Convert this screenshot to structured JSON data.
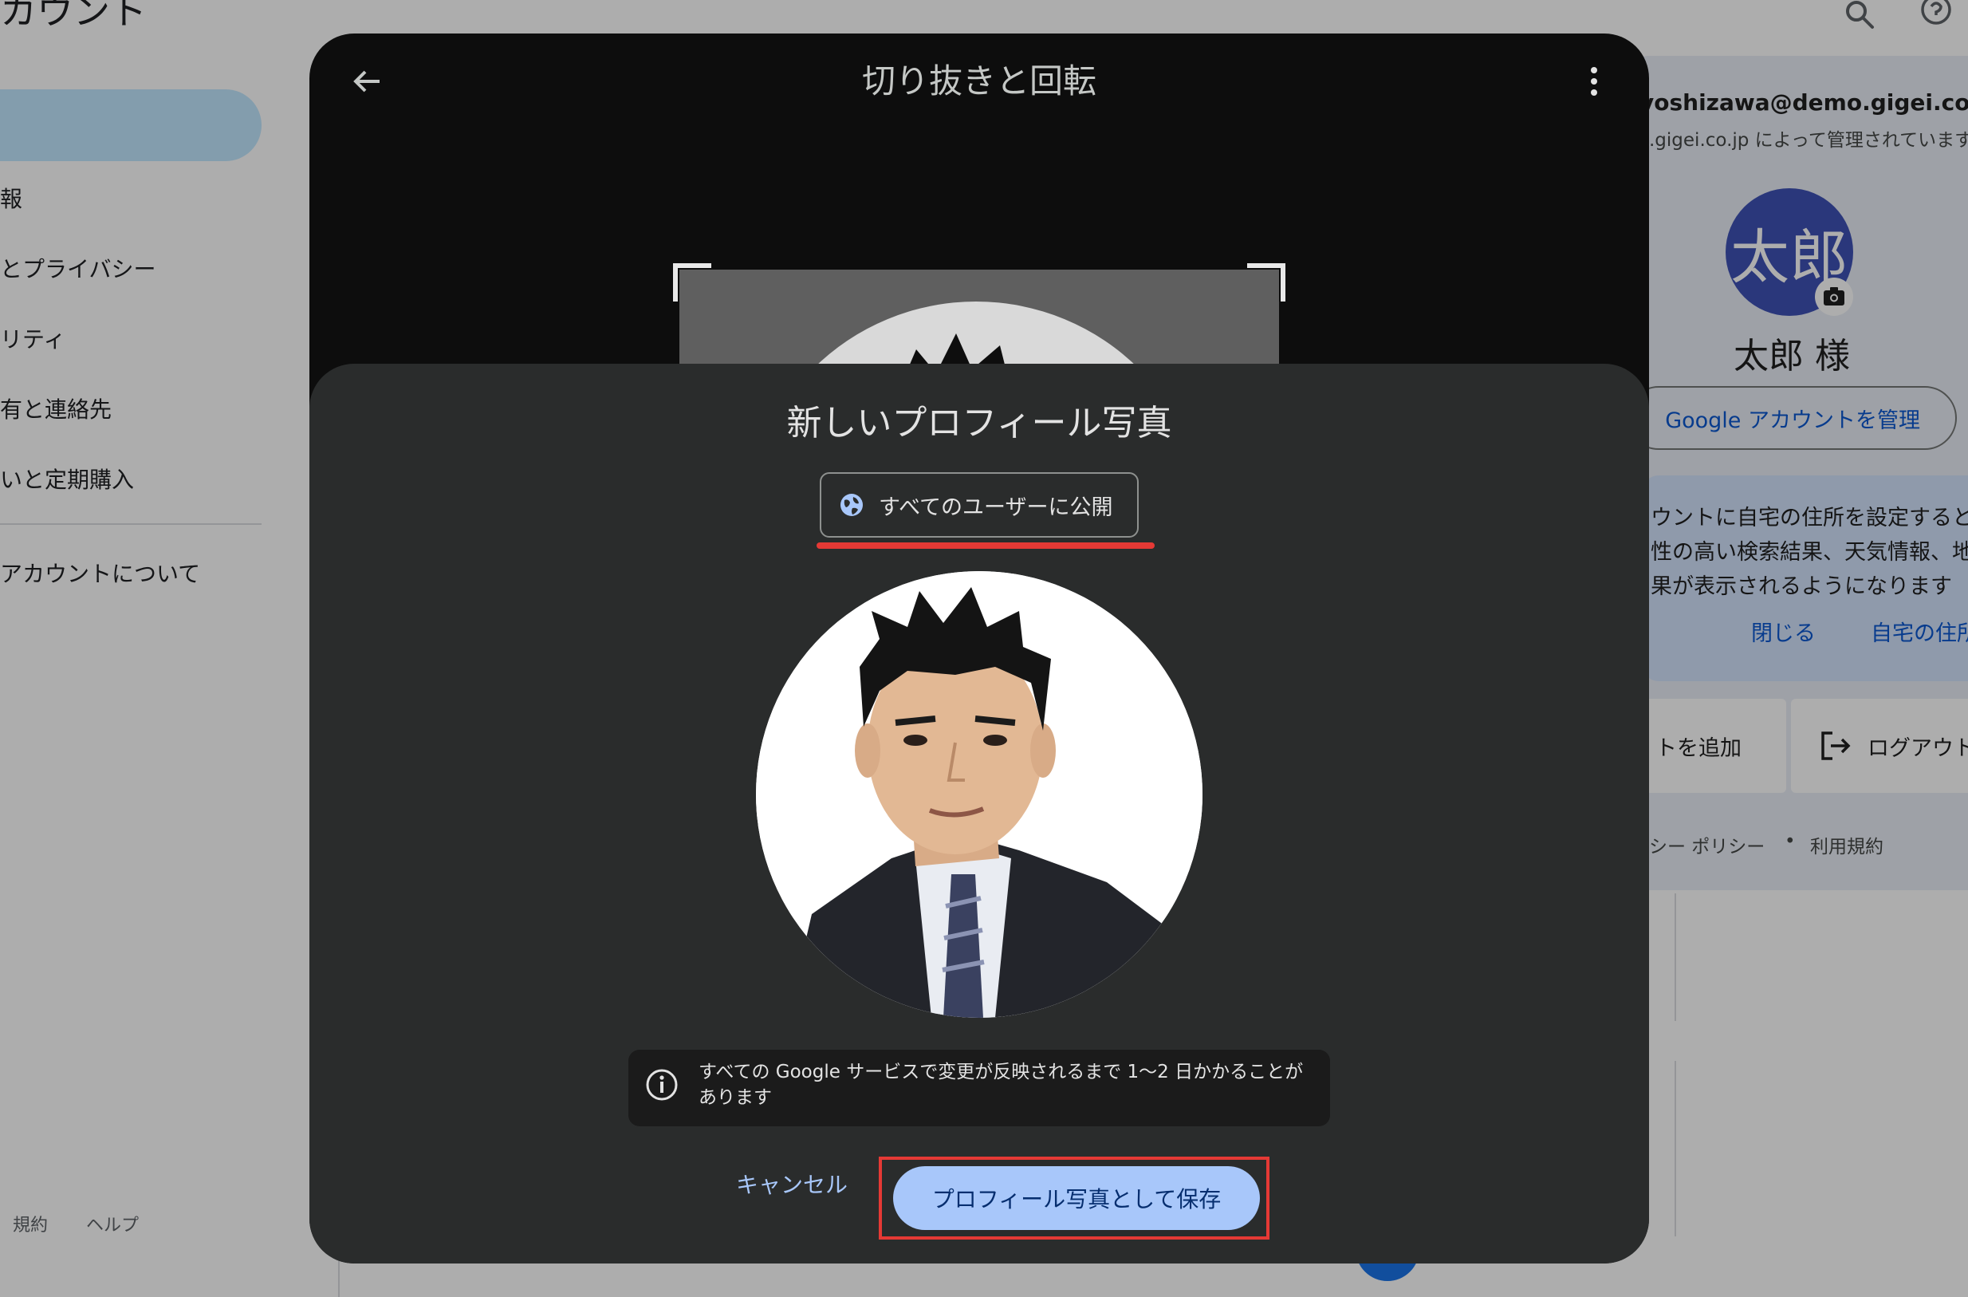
{
  "background": {
    "page_title": "カウント",
    "nav": {
      "items": [
        "報",
        "とプライバシー",
        "リティ",
        "有と連絡先",
        "いと定期購入",
        "アカウントについて"
      ]
    },
    "footer": {
      "terms": "規約",
      "help": "ヘルプ"
    },
    "icons": {
      "search": "search-icon",
      "help": "help-circle-icon"
    }
  },
  "account_panel": {
    "email": "yoshizawa@demo.gigei.co.jp",
    "managed_by": ".gigei.co.jp によって管理されています",
    "avatar_text": "太郎",
    "greeting": "太郎 様",
    "manage_button": "Google アカウントを管理",
    "home_card": {
      "lines": [
        "ウントに自宅の住所を設定すると",
        "性の高い検索結果、天気情報、地",
        "果が表示されるようになります"
      ],
      "close_link": "閉じる",
      "set_link": "自宅の住所"
    },
    "add_account_button": "トを追加",
    "logout_button": "ログアウト",
    "privacy_link": "シー ポリシー",
    "separator": "•",
    "terms_link": "利用規約"
  },
  "crop_dialog": {
    "title": "切り抜きと回転",
    "icons": {
      "back": "arrow-back-icon",
      "menu": "more-vert-icon"
    }
  },
  "confirm_sheet": {
    "title": "新しいプロフィール写真",
    "visibility_label": "すべてのユーザーに公開",
    "info_text": "すべての Google サービスで変更が反映されるまで 1〜2 日かかることがあります",
    "cancel_label": "キャンセル",
    "save_label": "プロフィール写真として保存",
    "colors": {
      "highlight": "#e53935",
      "primary": "#a8c7fa",
      "sheet_bg": "#2a2c2c"
    }
  }
}
